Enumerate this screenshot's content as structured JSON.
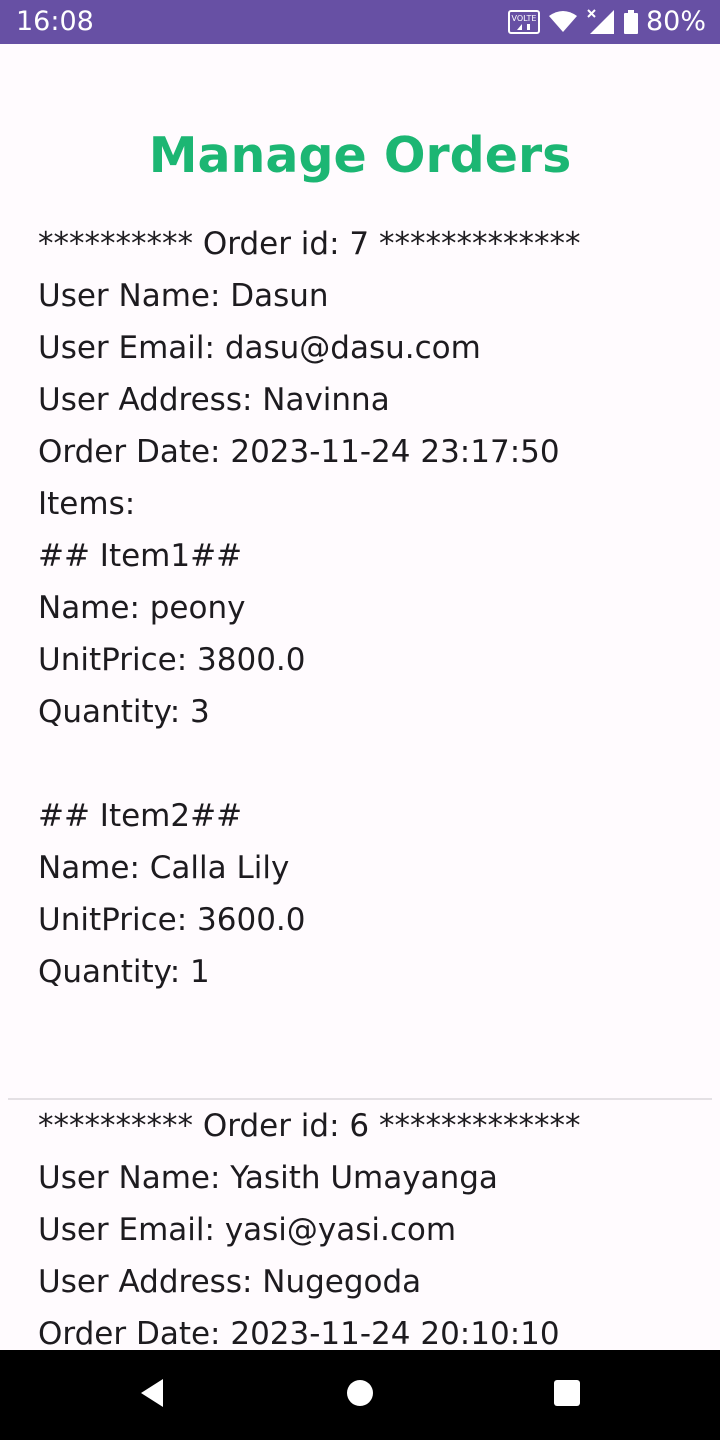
{
  "status_bar": {
    "time": "16:08",
    "volte_label": "VOLTE",
    "battery_percent": "80%",
    "icons": [
      "volte-icon",
      "wifi-icon",
      "signal-icon",
      "battery-icon"
    ]
  },
  "page": {
    "title": "Manage Orders",
    "title_color": "#1cb673"
  },
  "orders": [
    {
      "header": "********** Order id: 7 *************",
      "user_name": "User Name: Dasun",
      "user_email": "User Email: dasu@dasu.com",
      "user_address": "User Address: Navinna",
      "order_date": "Order Date: 2023-11-24 23:17:50",
      "items_label": "Items:",
      "items": [
        {
          "heading": "## Item1##",
          "name": "Name: peony",
          "unit_price": "UnitPrice: 3800.0",
          "quantity": "Quantity: 3"
        },
        {
          "heading": "## Item2##",
          "name": "Name: Calla Lily",
          "unit_price": "UnitPrice: 3600.0",
          "quantity": "Quantity: 1"
        }
      ]
    },
    {
      "header": "********** Order id: 6 *************",
      "user_name": "User Name: Yasith Umayanga",
      "user_email": "User Email: yasi@yasi.com",
      "user_address": "User Address: Nugegoda",
      "order_date": "Order Date: 2023-11-24 20:10:10"
    }
  ],
  "nav_bar": {
    "buttons": [
      "back-icon",
      "home-icon",
      "recents-icon"
    ]
  }
}
